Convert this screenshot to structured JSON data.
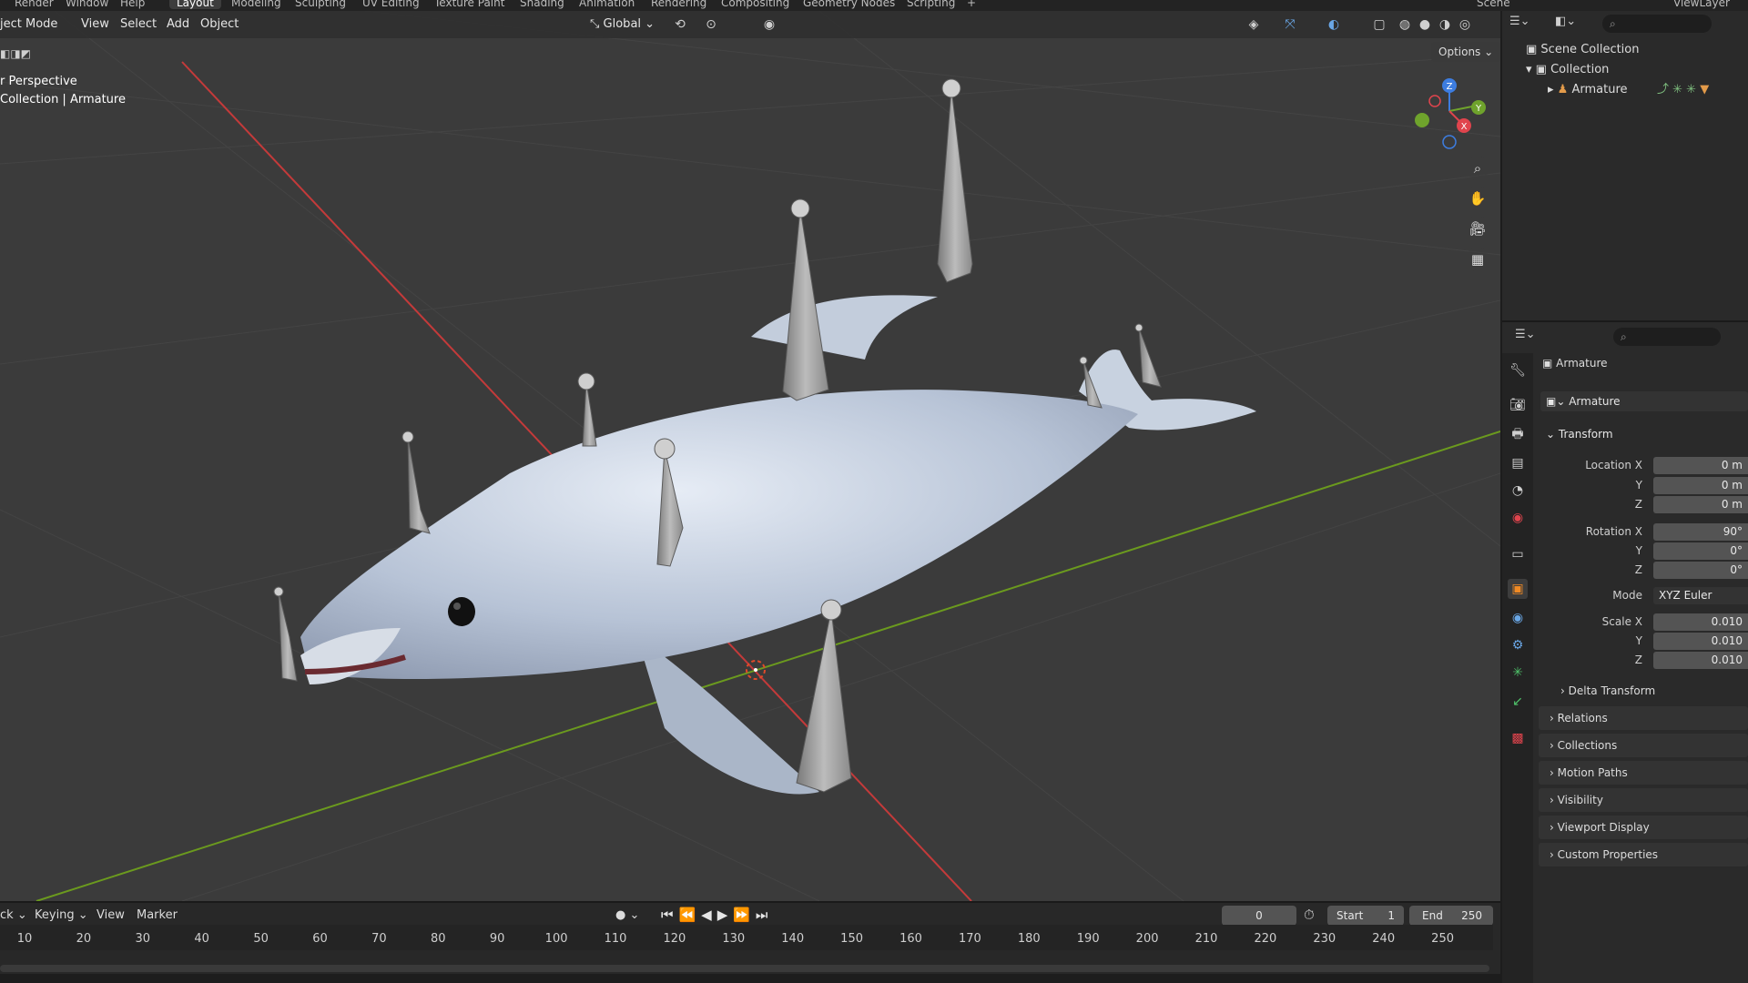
{
  "workspace_tabs": [
    {
      "label": "Render"
    },
    {
      "label": "Window"
    },
    {
      "label": "Help"
    },
    {
      "label": "Layout"
    },
    {
      "label": "Modeling"
    },
    {
      "label": "Sculpting"
    },
    {
      "label": "UV Editing"
    },
    {
      "label": "Texture Paint"
    },
    {
      "label": "Shading"
    },
    {
      "label": "Animation"
    },
    {
      "label": "Rendering"
    },
    {
      "label": "Compositing"
    },
    {
      "label": "Geometry Nodes"
    },
    {
      "label": "Scripting"
    },
    {
      "label": "+"
    }
  ],
  "top_right": {
    "scene": "Scene",
    "view_layer": "ViewLayer"
  },
  "viewport_header": {
    "mode": "ject Mode",
    "menus": [
      "View",
      "Select",
      "Add",
      "Object"
    ],
    "orientation": "Global",
    "options": "Options"
  },
  "viewport_overlay": {
    "view_name": "r Perspective",
    "object_path": "Collection | Armature"
  },
  "gizmo": {
    "z": "Z",
    "y": "Y",
    "x": "X"
  },
  "outliner": {
    "scene_collection": "Scene Collection",
    "collection": "Collection",
    "armature": "Armature"
  },
  "properties": {
    "object_name": "Armature",
    "data_name": "Armature",
    "transform_title": "Transform",
    "location_label": "Location X",
    "location": [
      "0 m",
      "0 m",
      "0 m"
    ],
    "rotation_label": "Rotation X",
    "rotation": [
      "90°",
      "0°",
      "0°"
    ],
    "mode_label": "Mode",
    "mode_value": "XYZ Euler",
    "scale_label": "Scale X",
    "scale": [
      "0.010",
      "0.010",
      "0.010"
    ],
    "axis_y": "Y",
    "axis_z": "Z",
    "delta": "Delta Transform",
    "panels": [
      "Relations",
      "Collections",
      "Motion Paths",
      "Visibility",
      "Viewport Display",
      "Custom Properties"
    ]
  },
  "timeline": {
    "menus": [
      "ck",
      "Keying",
      "View",
      "Marker"
    ],
    "current_frame": "0",
    "start_label": "Start",
    "start": "1",
    "end_label": "End",
    "end": "250",
    "ticks": [
      "10",
      "20",
      "30",
      "40",
      "50",
      "60",
      "70",
      "80",
      "90",
      "100",
      "110",
      "120",
      "130",
      "140",
      "150",
      "160",
      "170",
      "180",
      "190",
      "200",
      "210",
      "220",
      "230",
      "240",
      "250"
    ]
  },
  "colors": {
    "axis_x": "#c43a3a",
    "axis_y": "#6b9a1e",
    "mesh": "#c8d3e3",
    "bone": "#9a9a9a",
    "selection": "#f08a24"
  }
}
